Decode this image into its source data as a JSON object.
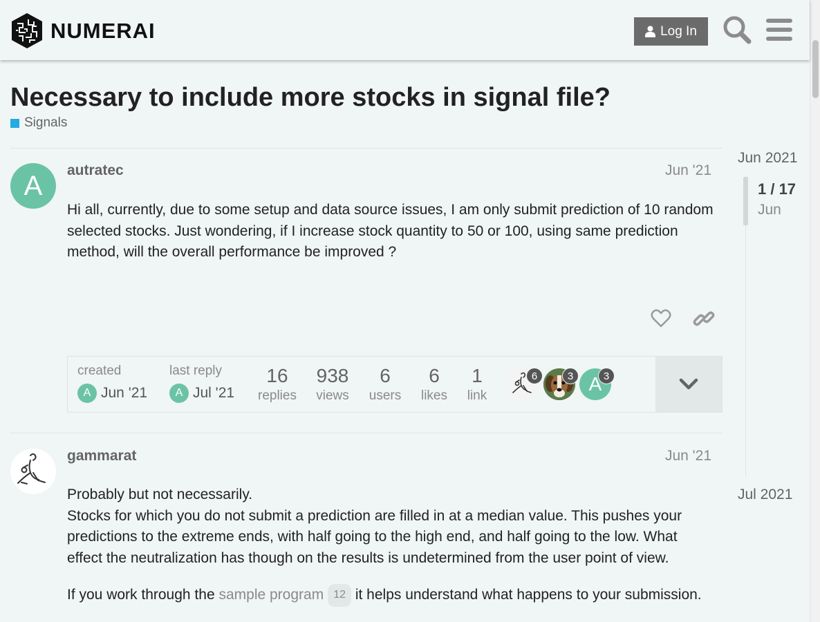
{
  "header": {
    "logo_text": "NUMERAI",
    "login_label": "Log In"
  },
  "topic": {
    "title": "Necessary to include more stocks in signal file?",
    "category": "Signals",
    "category_color": "#25aae2"
  },
  "posts": [
    {
      "avatar_letter": "A",
      "avatar_color": "#6bc3a5",
      "username": "autratec",
      "date": "Jun '21",
      "paragraphs": [
        "Hi all, currently, due to some setup and data source issues, I am only submit prediction of 10 random selected stocks. Just wondering, if I increase stock quantity to 50 or 100, using same prediction method, will the overall performance be improved ?"
      ]
    },
    {
      "avatar_icon": "kangaroo-sketch-avatar",
      "username": "gammarat",
      "date": "Jun '21",
      "paragraphs": [
        "Probably but not necessarily.",
        "Stocks for which you do not submit a prediction are filled in at a median value. This pushes your predictions to the extreme ends, with half going to the high end, and half going to the low. What effect the neutralization has though on the results is undetermined from the user point of view."
      ],
      "link_paragraph": {
        "before": "If you work through the",
        "link": "sample program",
        "clicks": "12",
        "after": "it helps understand what happens to your submission."
      }
    }
  ],
  "topic_map": {
    "created_label": "created",
    "created_avatar": "A",
    "created_date": "Jun '21",
    "last_reply_label": "last reply",
    "last_reply_avatar": "A",
    "last_reply_date": "Jul '21",
    "stats": [
      {
        "num": "16",
        "label": "replies"
      },
      {
        "num": "938",
        "label": "views"
      },
      {
        "num": "6",
        "label": "users"
      },
      {
        "num": "6",
        "label": "likes"
      },
      {
        "num": "1",
        "label": "link"
      }
    ],
    "participants": [
      {
        "icon": "kangaroo-sketch-avatar",
        "count": "6"
      },
      {
        "icon": "dog-photo-avatar",
        "count": "3"
      },
      {
        "letter": "A",
        "count": "3"
      }
    ]
  },
  "timeline": {
    "start": "Jun 2021",
    "progress": "1 / 17",
    "current": "Jun",
    "end": "Jul 2021"
  }
}
